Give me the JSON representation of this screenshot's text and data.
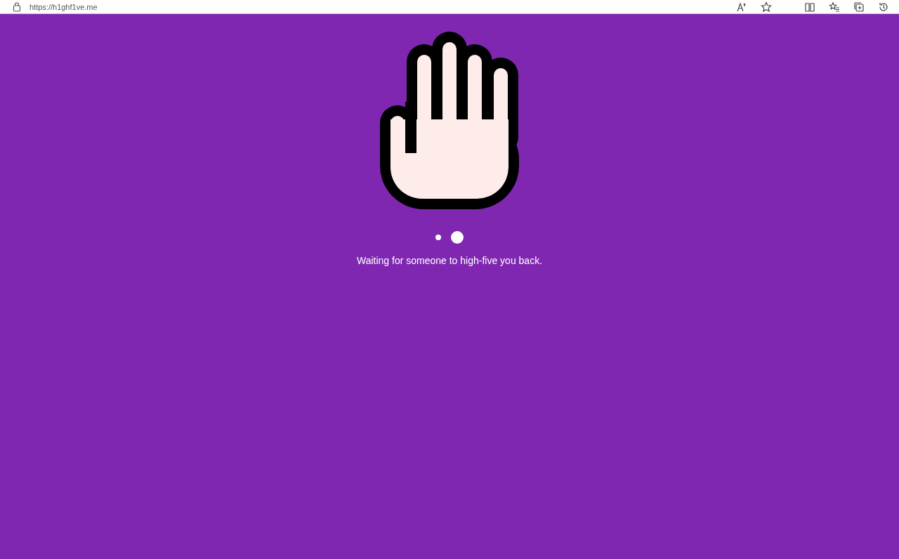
{
  "browser": {
    "url": "https://h1ghf1ve.me"
  },
  "dots": [
    {
      "selected": false
    },
    {
      "selected": true
    }
  ],
  "status": "Waiting for someone to high-five you back."
}
